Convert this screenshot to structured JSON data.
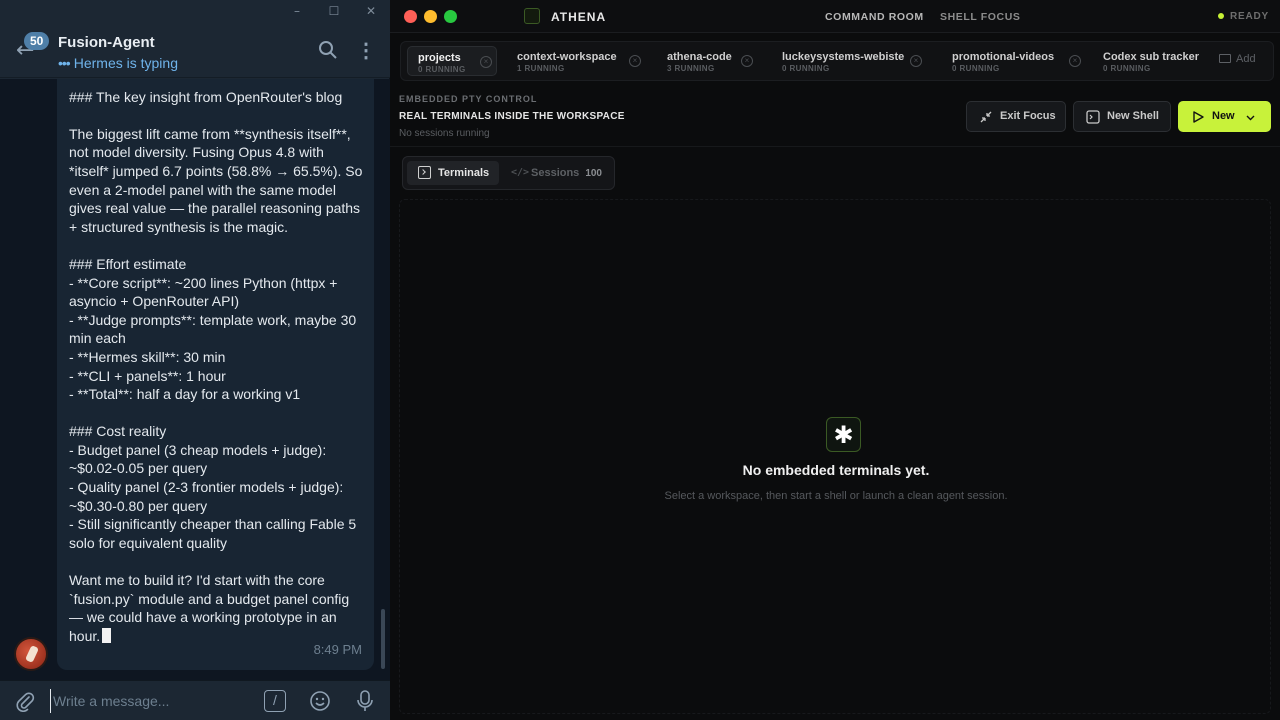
{
  "chat": {
    "title": "Fusion-Agent",
    "status": "Hermes is typing",
    "unread_badge": "50",
    "message_lines": [
      "",
      "### The key insight from OpenRouter's blog",
      "",
      "The biggest lift came from **synthesis itself**,",
      "not model diversity. Fusing Opus 4.8 with",
      "*itself* jumped 6.7 points (58.8% → 65.5%). So",
      "even a 2-model panel with the same model",
      "gives real value — the parallel reasoning paths",
      "+ structured synthesis is the magic.",
      "",
      "### Effort estimate",
      "- **Core script**: ~200 lines Python (httpx +",
      "asyncio + OpenRouter API)",
      "- **Judge prompts**: template work, maybe 30",
      "min each",
      "- **Hermes skill**: 30 min",
      "- **CLI + panels**: 1 hour",
      "- **Total**: half a day for a working v1",
      "",
      "### Cost reality",
      "- Budget panel (3 cheap models + judge):",
      "~$0.02-0.05 per query",
      "- Quality panel (2-3 frontier models + judge):",
      "~$0.30-0.80 per query",
      "- Still significantly cheaper than calling Fable 5",
      "solo for equivalent quality",
      "",
      "Want me to build it? I'd start with the core",
      "`fusion.py` module and a budget panel config",
      "— we could have a working prototype in an",
      "hour."
    ],
    "message_time": "8:49 PM",
    "input_placeholder": "Write a message...",
    "command_icon_glyph": "/",
    "icons": [
      "back-arrow-icon",
      "search-icon",
      "more-vertical-icon",
      "paperclip-icon",
      "command-icon",
      "emoji-icon",
      "microphone-icon"
    ]
  },
  "athena": {
    "app_name": "ATHENA",
    "modes": [
      "COMMAND ROOM",
      "SHELL FOCUS"
    ],
    "status": "READY",
    "accent_color": "#c8f23a",
    "tabs": [
      {
        "name": "projects",
        "count": "0 RUNNING",
        "active": true
      },
      {
        "name": "context-workspace",
        "count": "1 RUNNING",
        "active": false
      },
      {
        "name": "athena-code",
        "count": "3 RUNNING",
        "active": false
      },
      {
        "name": "luckeysystems-webiste",
        "count": "0 RUNNING",
        "active": false
      },
      {
        "name": "promotional-videos",
        "count": "0 RUNNING",
        "active": false
      },
      {
        "name": "Codex sub tracker",
        "count": "0 RUNNING",
        "active": false
      }
    ],
    "add_label": "Add",
    "section_label": "EMBEDDED PTY CONTROL",
    "section_title": "REAL TERMINALS INSIDE THE WORKSPACE",
    "section_sub": "No sessions running",
    "buttons": {
      "exit_focus": "Exit Focus",
      "new_shell": "New Shell",
      "new": "New"
    },
    "segments": {
      "terminals": "Terminals",
      "sessions": "Sessions",
      "sessions_count": "100"
    },
    "empty_state": {
      "glyph": "✱",
      "title": "No embedded terminals yet.",
      "subtitle": "Select a workspace, then start a shell or launch a clean agent session."
    }
  }
}
